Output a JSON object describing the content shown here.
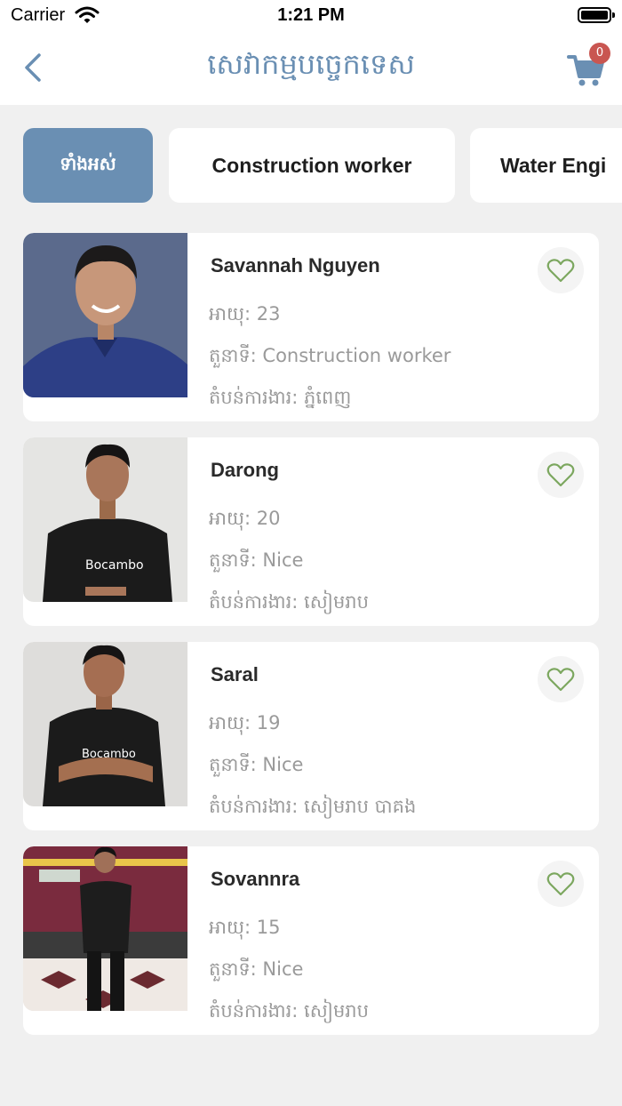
{
  "status_bar": {
    "carrier": "Carrier",
    "time": "1:21 PM"
  },
  "nav": {
    "title": "សេវាកម្មបច្ចេកទេស",
    "cart_count": "0"
  },
  "filters": [
    {
      "label": "ទាំងអស់",
      "active": true
    },
    {
      "label": "Construction worker",
      "active": false
    },
    {
      "label": "Water Engi",
      "active": false
    }
  ],
  "workers": [
    {
      "name": "Savannah Nguyen",
      "age": "អាយុ: 23",
      "position": "តួនាទី: Construction worker",
      "area": "តំបន់ការងារ: ភ្នំពេញ"
    },
    {
      "name": "Darong",
      "age": "អាយុ: 20",
      "position": "តួនាទី: Nice",
      "area": "តំបន់ការងារ: សៀមរាប"
    },
    {
      "name": "Saral",
      "age": "អាយុ: 19",
      "position": "តួនាទី: Nice",
      "area": "តំបន់ការងារ: សៀមរាប បាគង"
    },
    {
      "name": "Sovannra",
      "age": "អាយុ: 15",
      "position": "តួនាទី: Nice",
      "area": "តំបន់ការងារ: សៀមរាប"
    }
  ],
  "colors": {
    "accent": "#6a8fb3",
    "badge": "#c95651",
    "heart": "#7ca75f"
  }
}
